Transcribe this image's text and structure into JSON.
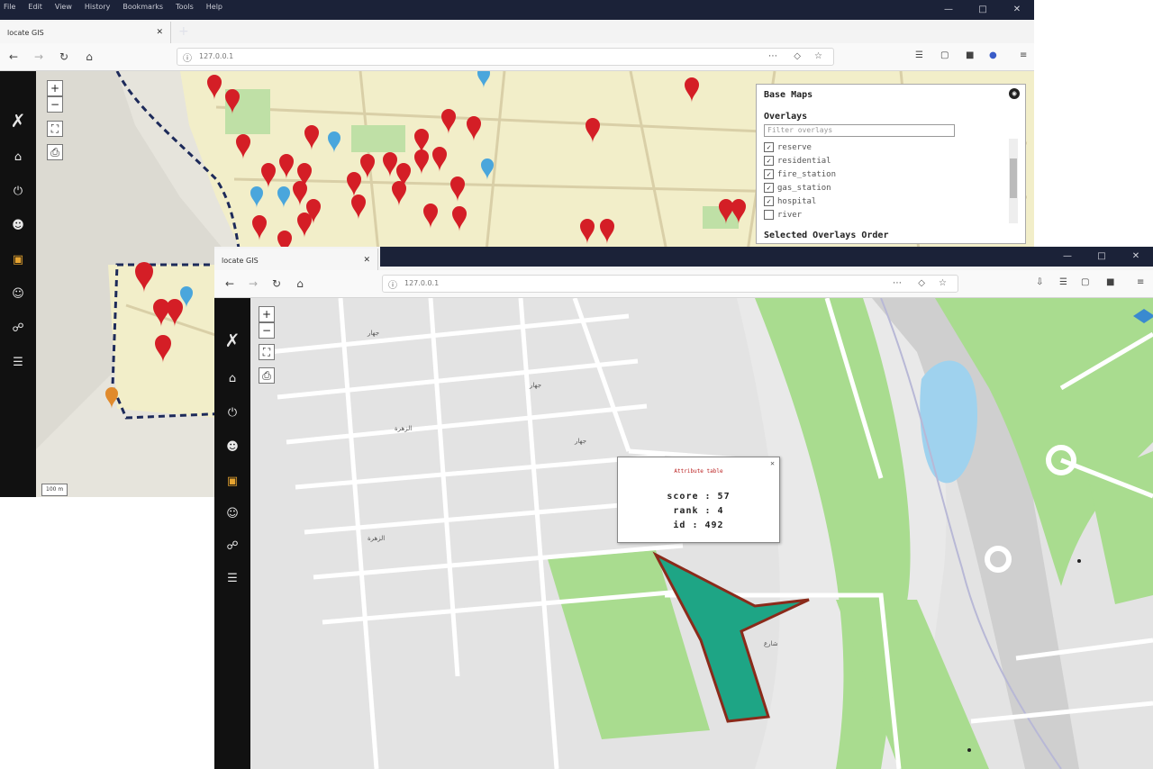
{
  "window1": {
    "menu": [
      "File",
      "Edit",
      "View",
      "History",
      "Bookmarks",
      "Tools",
      "Help"
    ],
    "tab_title": "locate GIS",
    "url": "127.0.0.1",
    "layer_panel": {
      "base_maps": "Base Maps",
      "overlays": "Overlays",
      "filter_placeholder": "Filter overlays",
      "layers": [
        {
          "name": "reserve",
          "checked": true
        },
        {
          "name": "residential",
          "checked": true
        },
        {
          "name": "fire_station",
          "checked": true
        },
        {
          "name": "gas_station",
          "checked": true
        },
        {
          "name": "hospital",
          "checked": true
        },
        {
          "name": "river",
          "checked": false
        }
      ],
      "selected_order": "Selected Overlays Order"
    },
    "scale": "100 m"
  },
  "window2": {
    "tab_title": "locate GIS",
    "url": "127.0.0.1",
    "popup": {
      "title": "Attribute table",
      "score": "score : 57",
      "rank": "rank : 4",
      "id": "id : 492"
    }
  },
  "colors": {
    "titlebar": "#1b2238",
    "sidebar": "#111111",
    "marker_red": "#d41e26",
    "marker_blue": "#4aa6dc",
    "parcel_fill": "#1ea585",
    "parcel_stroke": "#8b2a1a",
    "park_green": "#a9dc8f",
    "water": "#9fd2ee",
    "map_land_1": "#f2eec9",
    "map_land_2": "#e3e3e3"
  },
  "icons": {
    "sidebar": [
      "home-icon",
      "power-icon",
      "user-icon",
      "cars-icon",
      "admin-icon",
      "network-icon",
      "stack-icon"
    ]
  }
}
